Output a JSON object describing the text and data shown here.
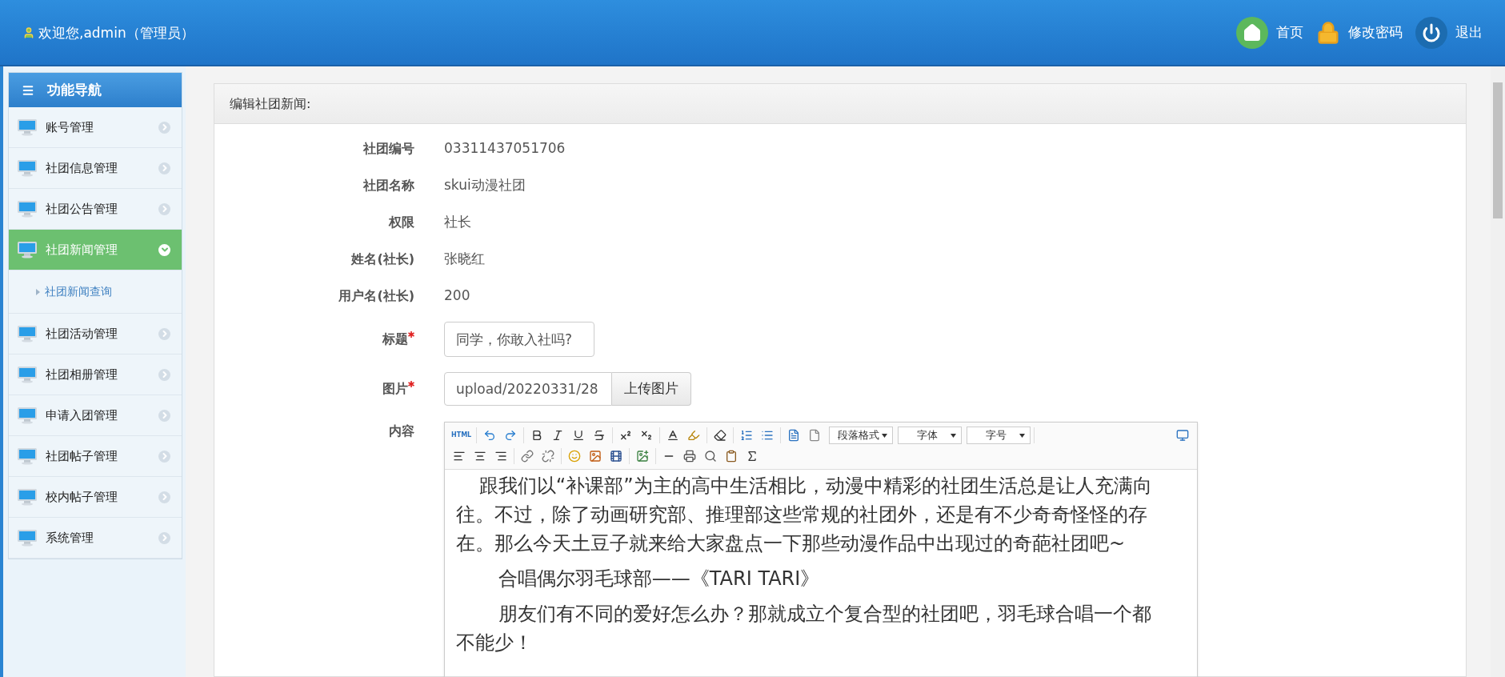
{
  "header": {
    "welcome": "欢迎您,admin（管理员）",
    "links": [
      {
        "kind": "home",
        "label": "首页"
      },
      {
        "kind": "password",
        "label": "修改密码"
      },
      {
        "kind": "logout",
        "label": "退出"
      }
    ]
  },
  "sidebar": {
    "title": "功能导航",
    "items": [
      {
        "label": "账号管理",
        "selected": false,
        "expanded": false
      },
      {
        "label": "社团信息管理",
        "selected": false,
        "expanded": false
      },
      {
        "label": "社团公告管理",
        "selected": false,
        "expanded": false
      },
      {
        "label": "社团新闻管理",
        "selected": true,
        "expanded": true,
        "children": [
          {
            "label": "社团新闻查询"
          }
        ]
      },
      {
        "label": "社团活动管理",
        "selected": false,
        "expanded": false
      },
      {
        "label": "社团相册管理",
        "selected": false,
        "expanded": false
      },
      {
        "label": "申请入团管理",
        "selected": false,
        "expanded": false
      },
      {
        "label": "社团帖子管理",
        "selected": false,
        "expanded": false
      },
      {
        "label": "校内帖子管理",
        "selected": false,
        "expanded": false
      },
      {
        "label": "系统管理",
        "selected": false,
        "expanded": false
      }
    ]
  },
  "panel": {
    "title": "编辑社团新闻:",
    "fields": [
      {
        "kind": "static",
        "label": "社团编号",
        "value": "03311437051706"
      },
      {
        "kind": "static",
        "label": "社团名称",
        "value": "skui动漫社团"
      },
      {
        "kind": "static",
        "label": "权限",
        "value": "社长"
      },
      {
        "kind": "static",
        "label": "姓名(社长)",
        "value": "张晓红"
      },
      {
        "kind": "static",
        "label": "用户名(社长)",
        "value": "200"
      },
      {
        "kind": "input",
        "label": "标题",
        "required": true,
        "value": "同学，你敢入社吗?"
      },
      {
        "kind": "upload",
        "label": "图片",
        "required": true,
        "value": "upload/20220331/28",
        "button": "上传图片"
      },
      {
        "kind": "editor",
        "label": "内容",
        "toolbar": {
          "html": "HTML",
          "dropdowns": [
            "段落格式",
            "字体",
            "字号"
          ]
        },
        "paragraphs": [
          "跟我们以“补课部”为主的高中生活相比，动漫中精彩的社团生活总是让人充满向往。不过，除了动画研究部、推理部这些常规的社团外，还是有不少奇奇怪怪的存在。那么今天土豆子就来给大家盘点一下那些动漫作品中出现过的奇葩社团吧~",
          "合唱偶尔羽毛球部——《TARI TARI》",
          "朋友们有不同的爱好怎么办？那就成立个复合型的社团吧，羽毛球合唱一个都不能少！"
        ]
      }
    ]
  }
}
